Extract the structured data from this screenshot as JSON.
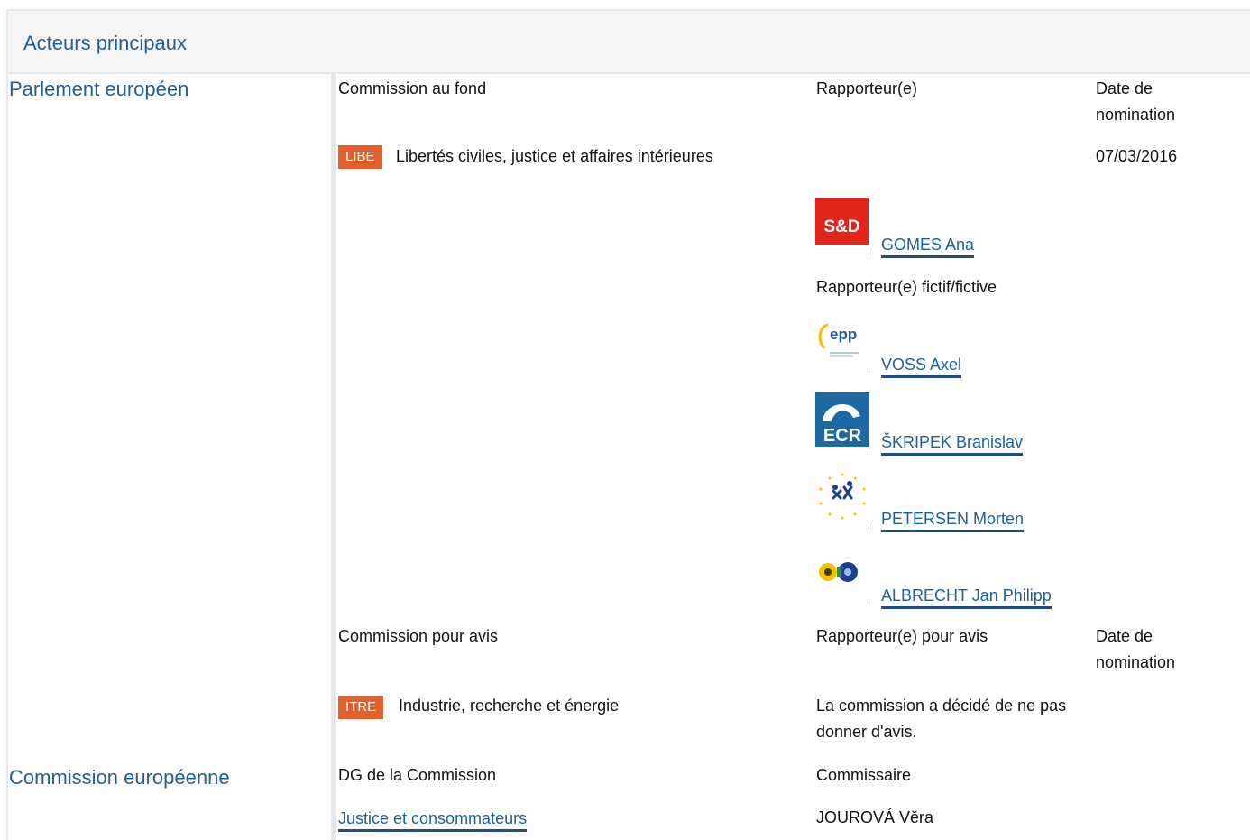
{
  "header": {
    "title": "Acteurs principaux"
  },
  "parliament": {
    "title": "Parlement européen",
    "lead": {
      "label_committee": "Commission au fond",
      "label_rapporteur": "Rapporteur(e)",
      "label_date": "Date de nomination",
      "committee_code": "LIBE",
      "committee_name": "Libertés civiles, justice et affaires intérieures",
      "date": "07/03/2016",
      "rapporteur": {
        "group_icon": "s-and-d-logo",
        "name": "GOMES Ana",
        "group_color": "#e2231a"
      },
      "shadow_label": "Rapporteur(e) fictif/fictive",
      "shadows": [
        {
          "group_icon": "epp-logo",
          "name": "VOSS Axel"
        },
        {
          "group_icon": "ecr-logo",
          "name": "ŠKRIPEK Branislav"
        },
        {
          "group_icon": "alde-logo",
          "name": "PETERSEN Morten"
        },
        {
          "group_icon": "greens-efa-logo",
          "name": "ALBRECHT Jan Philipp"
        }
      ]
    },
    "opinion": {
      "label_committee": "Commission pour avis",
      "label_rapporteur": "Rapporteur(e) pour avis",
      "label_date": "Date de nomination",
      "committee_code": "ITRE",
      "committee_name": "Industrie, recherche et énergie",
      "note": "La commission a décidé de ne pas donner d'avis."
    }
  },
  "commission": {
    "title": "Commission européenne",
    "label_dg": "DG de la Commission",
    "label_commissioner": "Commissaire",
    "dg": "Justice et consommateurs",
    "commissioner": "JOUROVÁ Věra"
  },
  "colors": {
    "accent_blue": "#1f5f96",
    "link_blue": "#1a61a3",
    "badge_orange": "#e35f2c"
  }
}
